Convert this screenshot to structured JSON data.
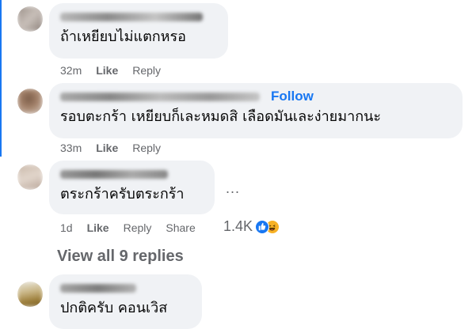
{
  "comments": [
    {
      "text": "ถ้าเหยียบไม่แตกหรอ",
      "time": "32m",
      "like": "Like",
      "reply": "Reply"
    },
    {
      "follow": "Follow",
      "text": "รอบตะกร้า เหยียบก็เละหมดสิ เลือดมันเละง่ายมากนะ",
      "time": "33m",
      "like": "Like",
      "reply": "Reply"
    },
    {
      "text": "ตระกร้าครับตระกร้า",
      "time": "1d",
      "like": "Like",
      "reply": "Reply",
      "share": "Share",
      "more": "...",
      "reaction_count": "1.4K"
    },
    {
      "text": "ปกติครับ คอนเวิส"
    }
  ],
  "view_replies": "View all 9 replies",
  "colors": {
    "link_blue": "#1877f2",
    "bubble_bg": "#f0f2f5",
    "meta_gray": "#65676b"
  },
  "icons": [
    "like-reaction-icon",
    "haha-reaction-icon",
    "more-options-icon"
  ]
}
